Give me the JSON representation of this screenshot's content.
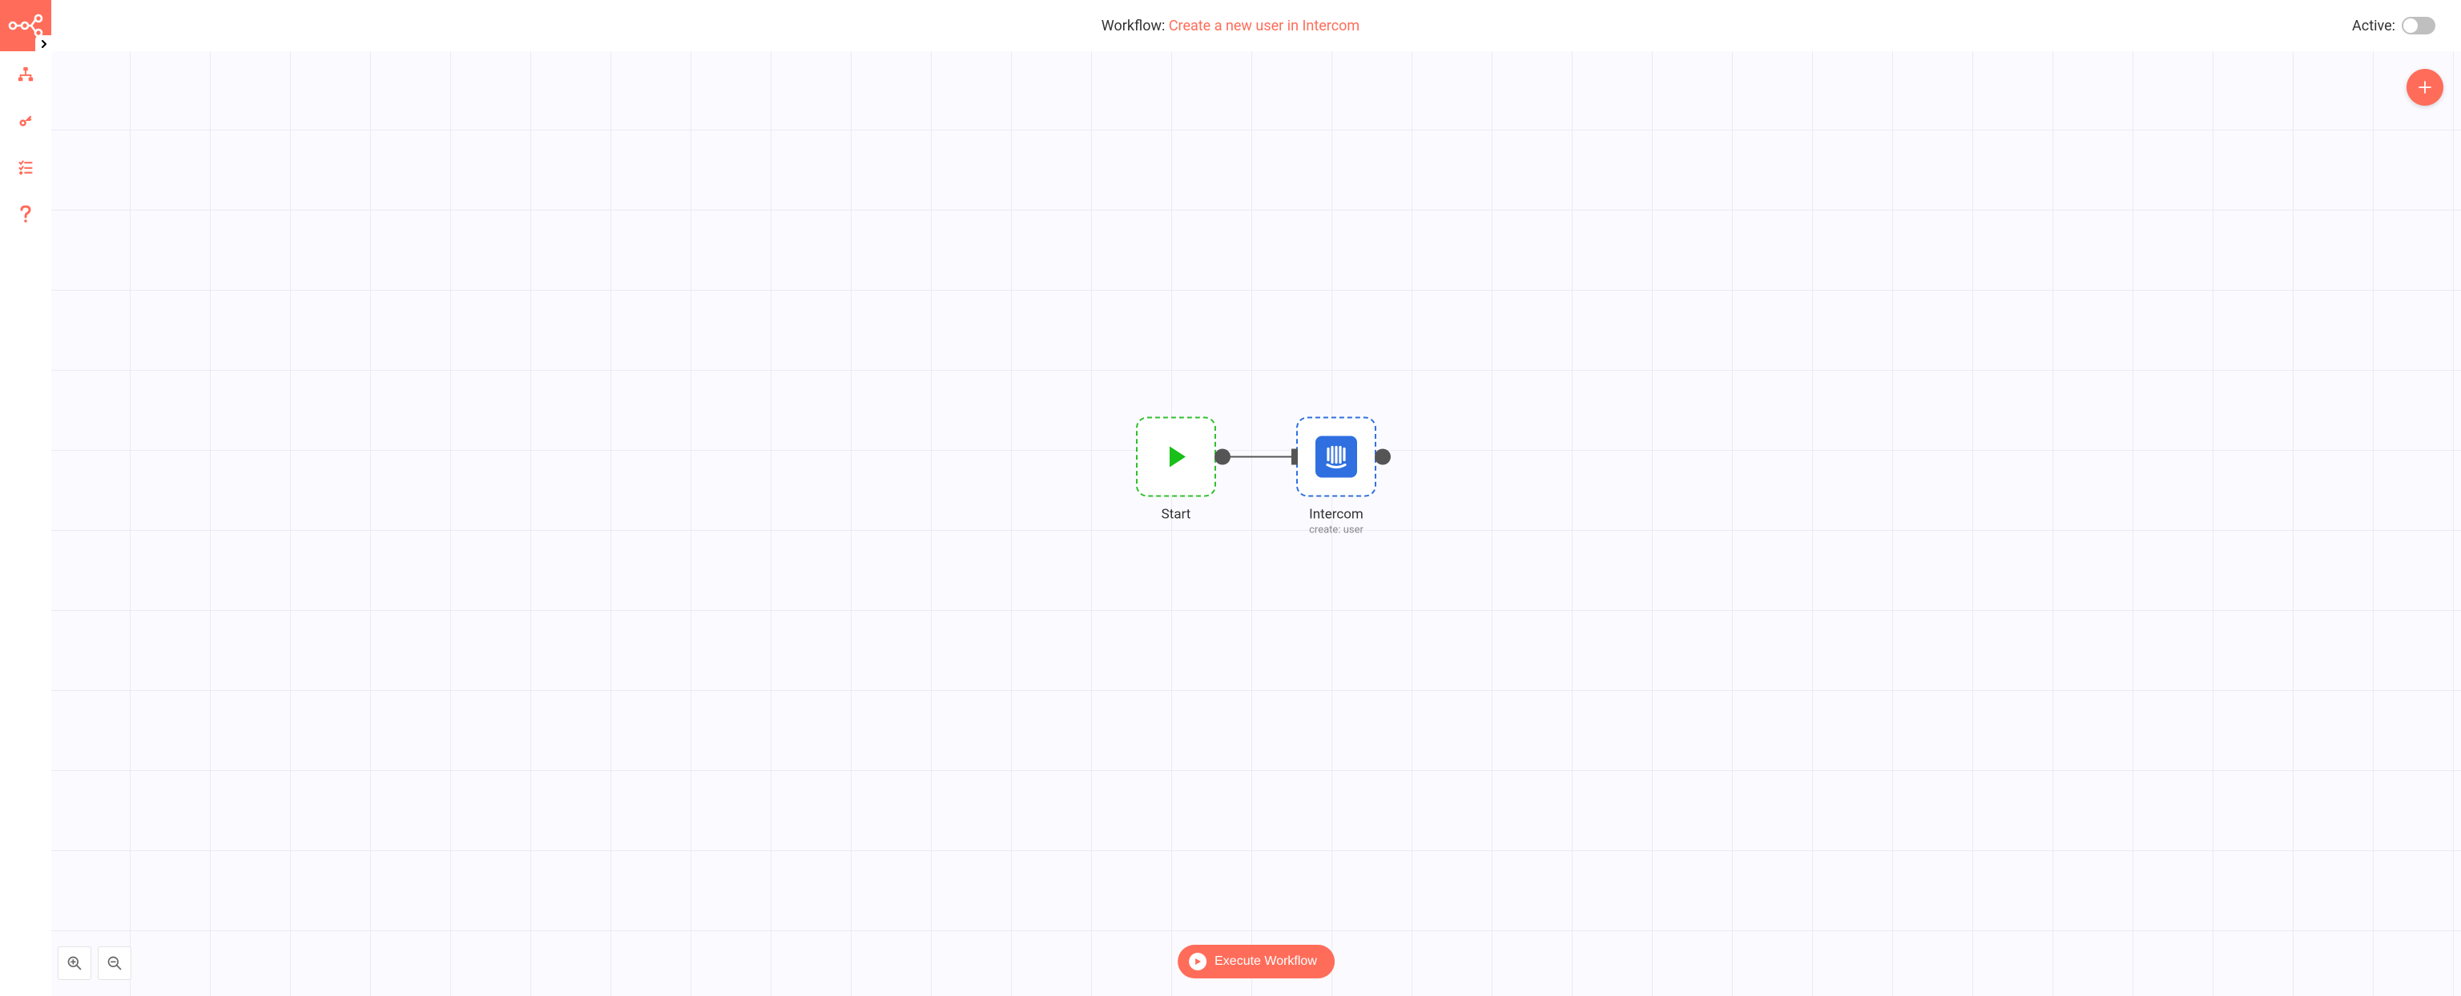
{
  "header": {
    "title_prefix": "Workflow: ",
    "workflow_name": "Create a new user in Intercom",
    "active_label": "Active:",
    "active": false
  },
  "sidebar": {
    "items": [
      "workflows",
      "credentials",
      "executions",
      "help"
    ]
  },
  "canvas": {
    "nodes": [
      {
        "id": "start",
        "label": "Start",
        "subtitle": "",
        "type": "trigger"
      },
      {
        "id": "intercom",
        "label": "Intercom",
        "subtitle": "create: user",
        "type": "action"
      }
    ],
    "connections": [
      {
        "from": "start",
        "to": "intercom"
      }
    ]
  },
  "buttons": {
    "execute": "Execute Workflow"
  },
  "icons": {
    "add": "plus-icon",
    "zoom_in": "zoom-in-icon",
    "zoom_out": "zoom-out-icon"
  }
}
